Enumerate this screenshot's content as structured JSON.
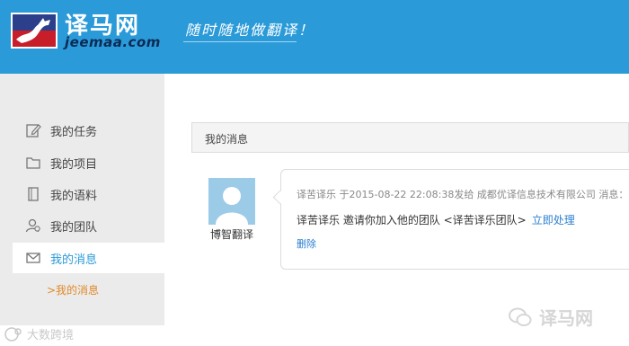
{
  "header": {
    "logo_cn": "译马网",
    "logo_en": "jeemaa.com",
    "slogan": "随时随地做翻译！"
  },
  "sidebar": {
    "items": [
      {
        "label": "我的任务",
        "icon": "edit-icon"
      },
      {
        "label": "我的项目",
        "icon": "folder-icon"
      },
      {
        "label": "我的语料",
        "icon": "document-icon"
      },
      {
        "label": "我的团队",
        "icon": "team-icon"
      },
      {
        "label": "我的消息",
        "icon": "mail-icon"
      }
    ],
    "active_item": "我的消息",
    "sub_item": ">我的消息"
  },
  "main": {
    "section_title": "我的消息",
    "message": {
      "sender_name": "博智翻译",
      "meta": "译苦译乐 于2015-08-22 22:08:38发给 成都优译信息技术有限公司 消息：",
      "body": "译苦译乐 邀请你加入他的团队 <译苦译乐团队>",
      "action": "立即处理",
      "delete": "删除"
    }
  },
  "watermarks": {
    "right": "译马网",
    "left": "大数跨境"
  },
  "colors": {
    "header_bg": "#2a9ad8",
    "sidebar_bg": "#ebebeb",
    "link": "#2a7fd0",
    "sub_item": "#e08a2a"
  }
}
